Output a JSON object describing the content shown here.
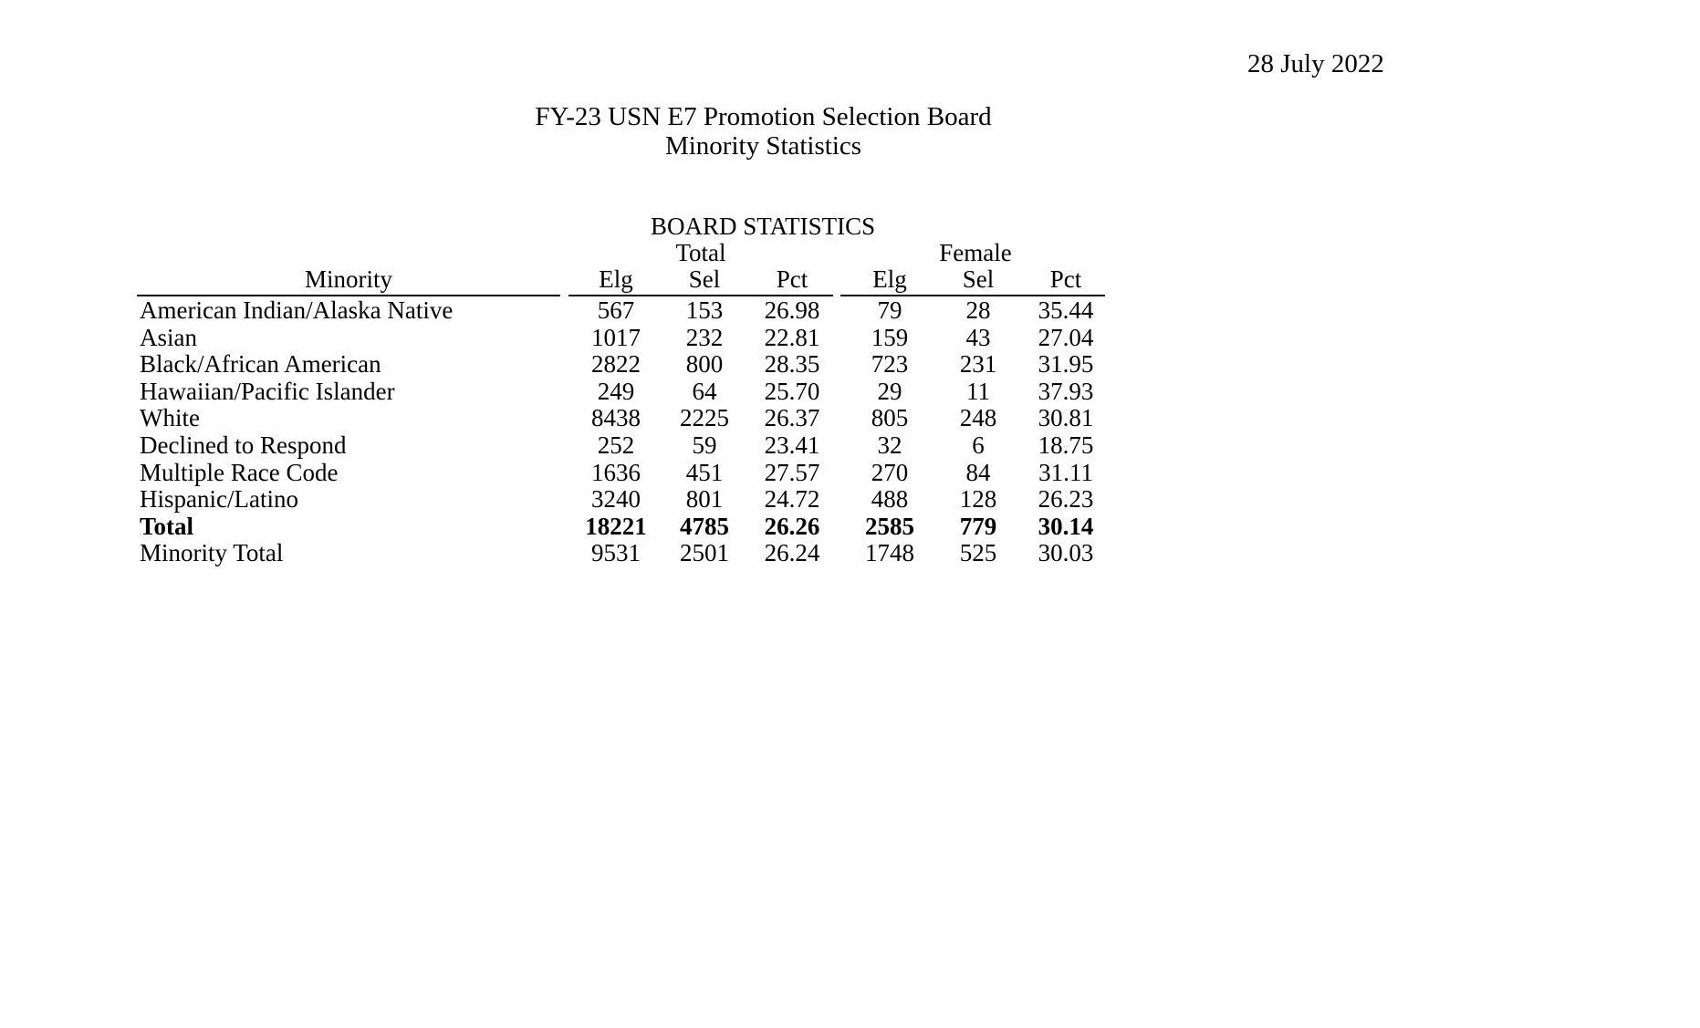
{
  "header": {
    "date": "28 July 2022",
    "title_line1": "FY-23 USN E7 Promotion Selection Board",
    "title_line2": "Minority Statistics"
  },
  "table": {
    "section_title": "BOARD STATISTICS",
    "group_labels": [
      "Total",
      "Female"
    ],
    "columns": [
      "Minority",
      "Elg",
      "Sel",
      "Pct",
      "Elg",
      "Sel",
      "Pct"
    ],
    "rows": [
      {
        "label": "American Indian/Alaska Native",
        "total_elg": "567",
        "total_sel": "153",
        "total_pct": "26.98",
        "female_elg": "79",
        "female_sel": "28",
        "female_pct": "35.44",
        "bold": false
      },
      {
        "label": "Asian",
        "total_elg": "1017",
        "total_sel": "232",
        "total_pct": "22.81",
        "female_elg": "159",
        "female_sel": "43",
        "female_pct": "27.04",
        "bold": false
      },
      {
        "label": "Black/African American",
        "total_elg": "2822",
        "total_sel": "800",
        "total_pct": "28.35",
        "female_elg": "723",
        "female_sel": "231",
        "female_pct": "31.95",
        "bold": false
      },
      {
        "label": "Hawaiian/Pacific Islander",
        "total_elg": "249",
        "total_sel": "64",
        "total_pct": "25.70",
        "female_elg": "29",
        "female_sel": "11",
        "female_pct": "37.93",
        "bold": false
      },
      {
        "label": "White",
        "total_elg": "8438",
        "total_sel": "2225",
        "total_pct": "26.37",
        "female_elg": "805",
        "female_sel": "248",
        "female_pct": "30.81",
        "bold": false
      },
      {
        "label": "Declined to Respond",
        "total_elg": "252",
        "total_sel": "59",
        "total_pct": "23.41",
        "female_elg": "32",
        "female_sel": "6",
        "female_pct": "18.75",
        "bold": false
      },
      {
        "label": "Multiple Race Code",
        "total_elg": "1636",
        "total_sel": "451",
        "total_pct": "27.57",
        "female_elg": "270",
        "female_sel": "84",
        "female_pct": "31.11",
        "bold": false
      },
      {
        "label": "Hispanic/Latino",
        "total_elg": "3240",
        "total_sel": "801",
        "total_pct": "24.72",
        "female_elg": "488",
        "female_sel": "128",
        "female_pct": "26.23",
        "bold": false
      },
      {
        "label": "Total",
        "total_elg": "18221",
        "total_sel": "4785",
        "total_pct": "26.26",
        "female_elg": "2585",
        "female_sel": "779",
        "female_pct": "30.14",
        "bold": true
      },
      {
        "label": "Minority Total",
        "total_elg": "9531",
        "total_sel": "2501",
        "total_pct": "26.24",
        "female_elg": "1748",
        "female_sel": "525",
        "female_pct": "30.03",
        "bold": false
      }
    ]
  }
}
